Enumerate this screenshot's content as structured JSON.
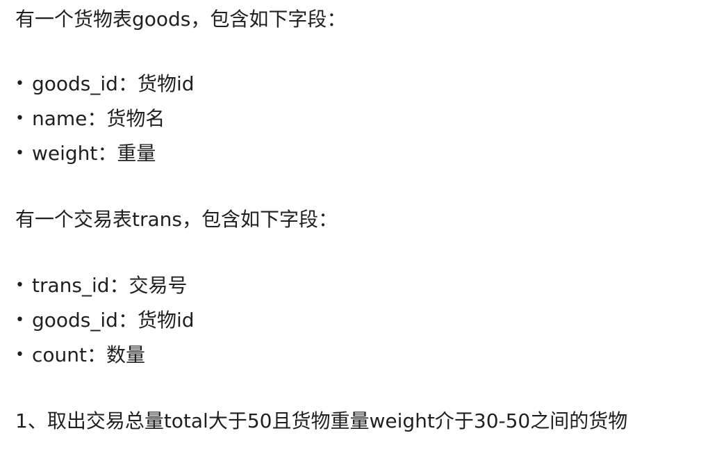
{
  "intro_goods": "有一个货物表goods，包含如下字段：",
  "goods_fields": [
    {
      "bullet": "•",
      "text": "goods_id：货物id"
    },
    {
      "bullet": "•",
      "text": "name：货物名"
    },
    {
      "bullet": "•",
      "text": "weight：重量"
    }
  ],
  "intro_trans": "有一个交易表trans，包含如下字段：",
  "trans_fields": [
    {
      "bullet": "•",
      "text": "trans_id：交易号"
    },
    {
      "bullet": "•",
      "text": "goods_id：货物id"
    },
    {
      "bullet": "•",
      "text": "count：数量"
    }
  ],
  "question_1": "1、取出交易总量total大于50且货物重量weight介于30-50之间的货物"
}
